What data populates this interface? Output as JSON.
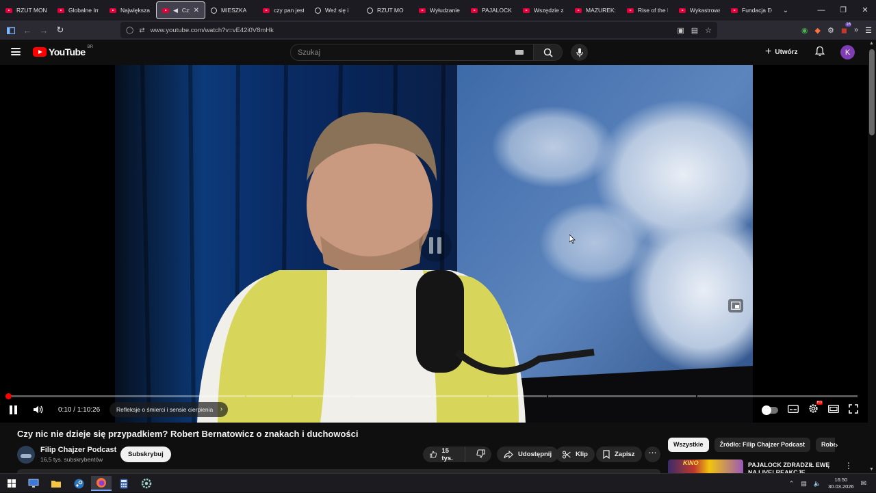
{
  "browser": {
    "tabs": [
      {
        "label": "RZUT MONE",
        "icon": "youtube-favicon"
      },
      {
        "label": "Globalne Imp",
        "icon": "youtube-favicon"
      },
      {
        "label": "Największa Ta",
        "icon": "youtube-favicon"
      },
      {
        "label": "Czy ni",
        "icon": "youtube-favicon",
        "active": true
      },
      {
        "label": "MIESZKA",
        "icon": "youtube-favicon"
      },
      {
        "label": "czy pan jest z",
        "icon": "youtube-favicon"
      },
      {
        "label": "Weź się i",
        "icon": "youtube-favicon"
      },
      {
        "label": "RZUT MO",
        "icon": "youtube-favicon"
      },
      {
        "label": "Wyłudzanie p",
        "icon": "youtube-favicon"
      },
      {
        "label": "PAJALOCK ZD",
        "icon": "youtube-favicon"
      },
      {
        "label": "Wszędzie zał",
        "icon": "youtube-favicon"
      },
      {
        "label": "MAZUREK: K",
        "icon": "youtube-favicon"
      },
      {
        "label": "Rise of the N",
        "icon": "youtube-favicon"
      },
      {
        "label": "Wykastrowac",
        "icon": "youtube-favicon"
      },
      {
        "label": "Fundacja ECF",
        "icon": "youtube-favicon"
      }
    ],
    "url": "www.youtube.com/watch?v=vE42i0V8mHk",
    "extensions_badge": "16"
  },
  "youtube": {
    "logo_text": "YouTube",
    "logo_country": "BR",
    "search_placeholder": "Szukaj",
    "create_label": "Utwórz",
    "avatar_letter": "K"
  },
  "player": {
    "time_current": "0:10",
    "time_separator": " / ",
    "time_total": "1:10:26",
    "chapter_label": "Refleksje o śmierci i sensie cierpienia",
    "played_fraction": 0.003,
    "hd_badge": "HD",
    "chapter_segments": [
      0.28,
      0.055,
      0.07,
      0.095,
      0.065,
      0.07,
      0.175,
      0.19
    ]
  },
  "video": {
    "title": "Czy nic nie dzieje się przypadkiem? Robert Bernatowicz o znakach i duchowości",
    "channel_name": "Filip Chajzer Podcast",
    "channel_subs": "16,5 tys. subskrybentów",
    "subscribe_label": "Subskrybuj",
    "likes": "15 tys.",
    "share_label": "Udostępnij",
    "clip_label": "Klip",
    "save_label": "Zapisz"
  },
  "sidebar": {
    "chips": [
      "Wszystkie",
      "Źródło: Filip Chajzer Podcast",
      "Robe"
    ],
    "recommendation_title": "PAJALOCK ZDRADZIŁ EWĘ NA LIVE! REAKCJE STREAMERÓ",
    "recommendation_thumb_text": "KINO"
  },
  "taskbar": {
    "time": "16:50",
    "date": "30.03.2026"
  },
  "colors": {
    "yt_red": "#ff0000",
    "bg": "#0f0f0f",
    "avatar": "#7e3db3"
  }
}
